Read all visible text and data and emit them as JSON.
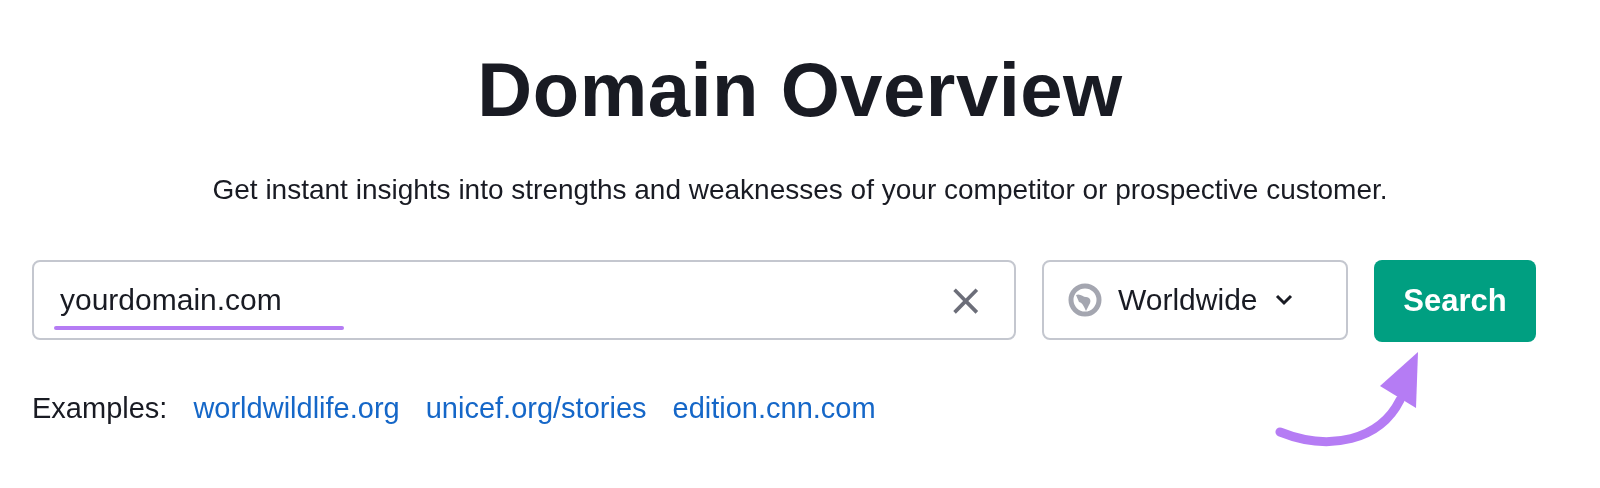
{
  "title": "Domain Overview",
  "subtitle": "Get instant insights into strengths and weaknesses of your competitor or prospective customer.",
  "search": {
    "value": "yourdomain.com",
    "clear_icon": "×"
  },
  "region": {
    "label": "Worldwide"
  },
  "search_button": {
    "label": "Search"
  },
  "examples": {
    "label": "Examples:",
    "links": [
      "worldwildlife.org",
      "unicef.org/stories",
      "edition.cnn.com"
    ]
  }
}
